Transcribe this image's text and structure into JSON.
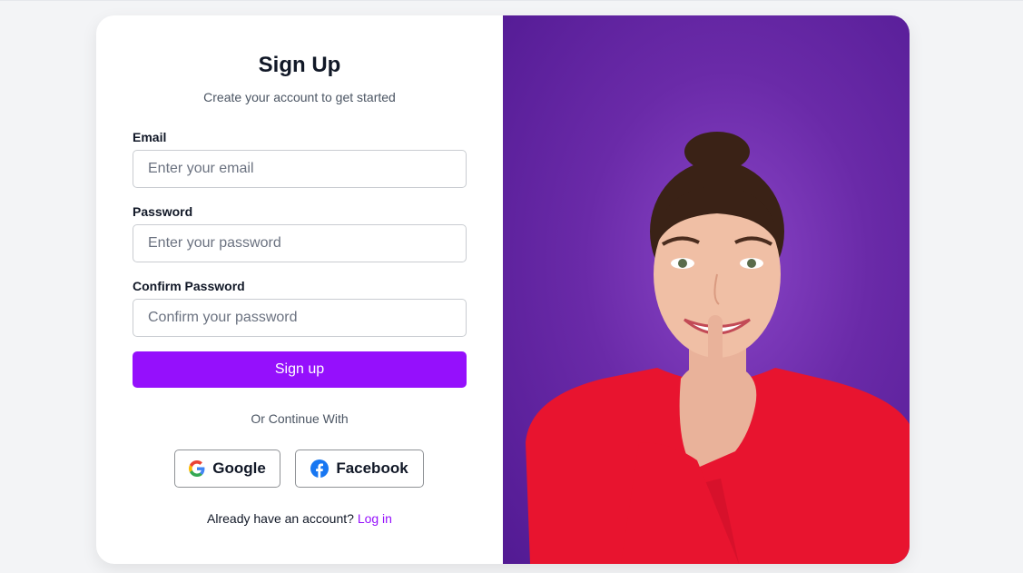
{
  "form": {
    "title": "Sign Up",
    "subtitle": "Create your account to get started",
    "email": {
      "label": "Email",
      "placeholder": "Enter your email",
      "value": ""
    },
    "password": {
      "label": "Password",
      "placeholder": "Enter your password",
      "value": ""
    },
    "confirm": {
      "label": "Confirm Password",
      "placeholder": "Confirm your password",
      "value": ""
    },
    "submit_label": "Sign up",
    "divider": "Or Continue With",
    "google_label": "Google",
    "facebook_label": "Facebook",
    "footer_prefix": "Already have an account?",
    "login_link": "Log in"
  },
  "colors": {
    "accent": "#9510fc",
    "image_background": "#5b1f9c",
    "sweater": "#e8142f"
  },
  "icons": {
    "google": "google-icon",
    "facebook": "facebook-icon"
  }
}
